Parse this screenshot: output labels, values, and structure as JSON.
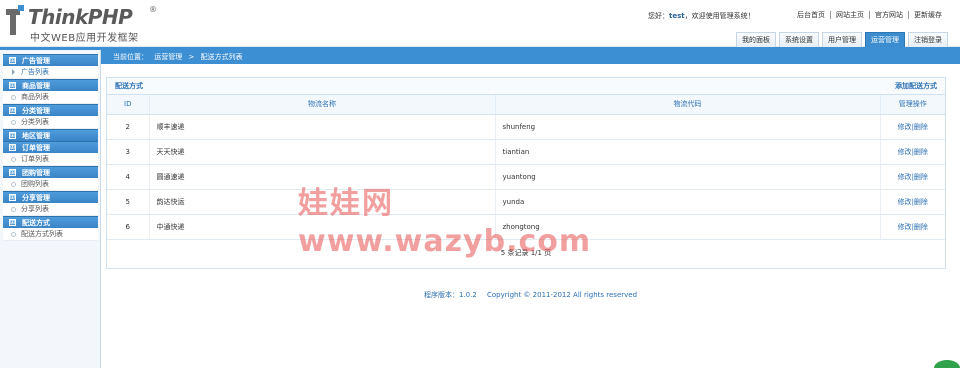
{
  "logo": {
    "title": "ThinkPHP",
    "reg": "®",
    "subtitle": "中文WEB应用开发框架"
  },
  "header": {
    "welcome_prefix": "您好：",
    "username": "test",
    "welcome_suffix": "，欢迎使用管理系统！",
    "links": [
      "后台首页",
      "网站主页",
      "官方网站",
      "更新缓存"
    ],
    "tabs": [
      {
        "label": "我的面板",
        "active": false
      },
      {
        "label": "系统设置",
        "active": false
      },
      {
        "label": "用户管理",
        "active": false
      },
      {
        "label": "运营管理",
        "active": true
      },
      {
        "label": "注销登录",
        "active": false
      }
    ]
  },
  "sidebar": {
    "groups": [
      {
        "title": "广告管理",
        "items": [
          {
            "label": "广告列表",
            "active": true
          }
        ]
      },
      {
        "title": "商品管理",
        "items": [
          {
            "label": "商品列表",
            "active": false
          }
        ]
      },
      {
        "title": "分类管理",
        "items": [
          {
            "label": "分类列表",
            "active": false
          }
        ]
      },
      {
        "title": "地区管理",
        "items": []
      },
      {
        "title": "订单管理",
        "items": [
          {
            "label": "订单列表",
            "active": false
          }
        ]
      },
      {
        "title": "团购管理",
        "items": [
          {
            "label": "团购列表",
            "active": false
          }
        ]
      },
      {
        "title": "分享管理",
        "items": [
          {
            "label": "分享列表",
            "active": false
          }
        ]
      },
      {
        "title": "配送方式",
        "items": [
          {
            "label": "配送方式列表",
            "active": false
          }
        ]
      }
    ],
    "group_icon": "⊞"
  },
  "breadcrumb": {
    "prefix": "当前位置：",
    "items": [
      "运营管理",
      "配送方式列表"
    ],
    "separator": ">"
  },
  "panel": {
    "title": "配送方式",
    "add_link": "添加配送方式",
    "columns": [
      "ID",
      "物流名称",
      "物流代码",
      "管理操作"
    ],
    "rows": [
      {
        "id": "2",
        "name": "顺丰速递",
        "code": "shunfeng"
      },
      {
        "id": "3",
        "name": "天天快递",
        "code": "tiantian"
      },
      {
        "id": "4",
        "name": "圆通速递",
        "code": "yuantong"
      },
      {
        "id": "5",
        "name": "韵达快运",
        "code": "yunda"
      },
      {
        "id": "6",
        "name": "中通快递",
        "code": "zhongtong"
      }
    ],
    "edit_label": "修改",
    "op_separator": "|",
    "delete_label": "删除",
    "pager": "5 条记录 1/1 页"
  },
  "footer": {
    "version": "程序版本：1.0.2",
    "copyright": "Copyright © 2011-2012 All rights reserved"
  },
  "watermark": {
    "line1": "娃娃网",
    "line2": "www.wazyb.com"
  },
  "colors": {
    "accent": "#3d8fd3",
    "link": "#2a6fb3",
    "watermark": "#e85050"
  }
}
